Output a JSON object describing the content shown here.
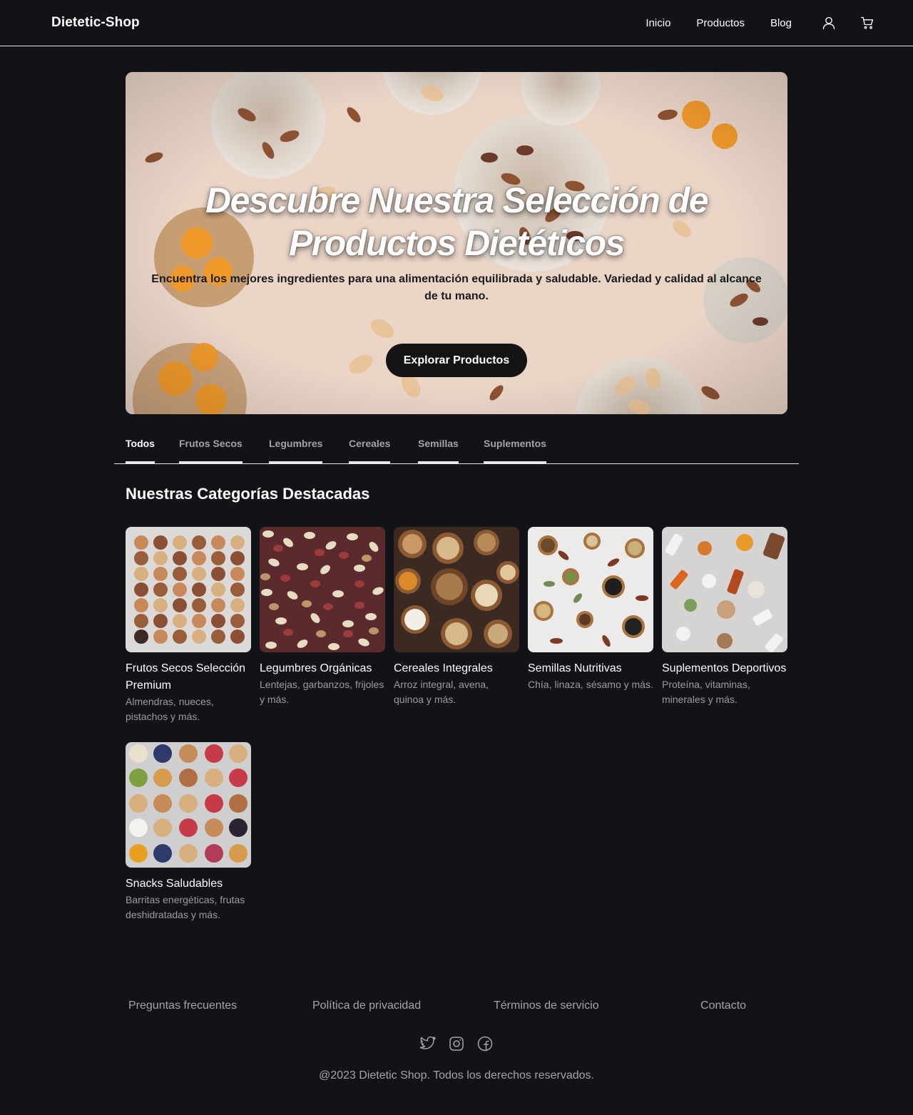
{
  "header": {
    "brand": "Dietetic-Shop",
    "nav": [
      "Inicio",
      "Productos",
      "Blog"
    ],
    "icons": [
      "user-icon",
      "cart-icon"
    ]
  },
  "hero": {
    "title_line1": "Descubre Nuestra Selección de",
    "title_line2": "Productos Dietéticos",
    "subtitle": "Encuentra los mejores ingredientes para una alimentación equilibrada y saludable. Variedad y calidad al alcance de tu mano.",
    "button": "Explorar Productos"
  },
  "tabs": {
    "items": [
      "Todos",
      "Frutos Secos",
      "Legumbres",
      "Cereales",
      "Semillas",
      "Suplementos"
    ],
    "active": "Todos"
  },
  "categories": {
    "title": "Nuestras Categorías Destacadas",
    "items": [
      {
        "title": "Frutos Secos Selección Premium",
        "desc": "Almendras, nueces, pistachos y más."
      },
      {
        "title": "Legumbres Orgánicas",
        "desc": "Lentejas, garbanzos, frijoles y más."
      },
      {
        "title": "Cereales Integrales",
        "desc": "Arroz integral, avena, quinoa y más."
      },
      {
        "title": "Semillas Nutritivas",
        "desc": "Chía, linaza, sésamo y más."
      },
      {
        "title": "Suplementos Deportivos",
        "desc": "Proteína, vitaminas, minerales y más."
      },
      {
        "title": "Snacks Saludables",
        "desc": "Barritas energéticas, frutas deshidratadas y más."
      }
    ]
  },
  "footer": {
    "links": [
      "Preguntas frecuentes",
      "Política de privacidad",
      "Términos de servicio",
      "Contacto"
    ],
    "socials": [
      "twitter-icon",
      "instagram-icon",
      "facebook-icon"
    ],
    "copyright": "@2023 Dietetic Shop. Todos los derechos reservados."
  },
  "colors": {
    "background": "#121317",
    "text": "#ffffff",
    "muted": "#a3a3a8",
    "button": "#141414"
  }
}
